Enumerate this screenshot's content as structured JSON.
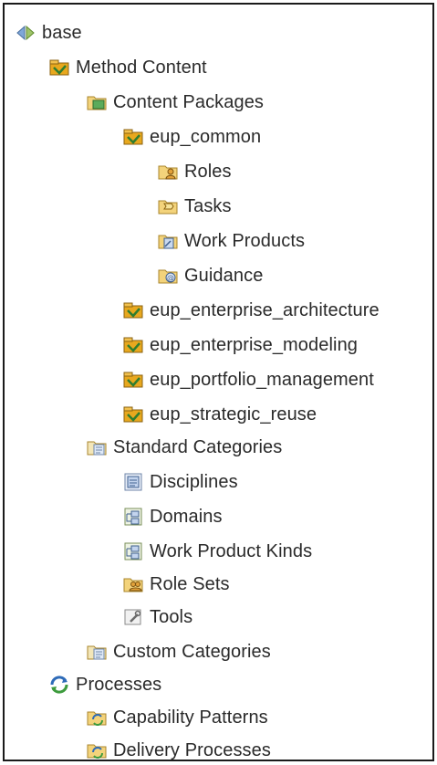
{
  "tree": {
    "items": [
      {
        "label": "base",
        "icon": "library-icon"
      },
      {
        "label": "Method Content",
        "icon": "method-plugin-icon"
      },
      {
        "label": "Content Packages",
        "icon": "content-packages-folder-icon"
      },
      {
        "label": "eup_common",
        "icon": "content-package-icon"
      },
      {
        "label": "Roles",
        "icon": "roles-folder-icon"
      },
      {
        "label": "Tasks",
        "icon": "tasks-folder-icon"
      },
      {
        "label": "Work Products",
        "icon": "work-products-folder-icon"
      },
      {
        "label": "Guidance",
        "icon": "guidance-folder-icon"
      },
      {
        "label": "eup_enterprise_architecture",
        "icon": "content-package-icon"
      },
      {
        "label": "eup_enterprise_modeling",
        "icon": "content-package-icon"
      },
      {
        "label": "eup_portfolio_management",
        "icon": "content-package-icon"
      },
      {
        "label": "eup_strategic_reuse",
        "icon": "content-package-icon"
      },
      {
        "label": "Standard Categories",
        "icon": "standard-categories-folder-icon"
      },
      {
        "label": "Disciplines",
        "icon": "disciplines-folder-icon"
      },
      {
        "label": "Domains",
        "icon": "domains-folder-icon"
      },
      {
        "label": "Work Product Kinds",
        "icon": "work-product-kinds-folder-icon"
      },
      {
        "label": "Role Sets",
        "icon": "role-sets-folder-icon"
      },
      {
        "label": "Tools",
        "icon": "tools-folder-icon"
      },
      {
        "label": "Custom Categories",
        "icon": "custom-categories-folder-icon"
      },
      {
        "label": "Processes",
        "icon": "processes-icon"
      },
      {
        "label": "Capability Patterns",
        "icon": "capability-patterns-folder-icon"
      },
      {
        "label": "Delivery Processes",
        "icon": "delivery-processes-folder-icon"
      }
    ]
  }
}
